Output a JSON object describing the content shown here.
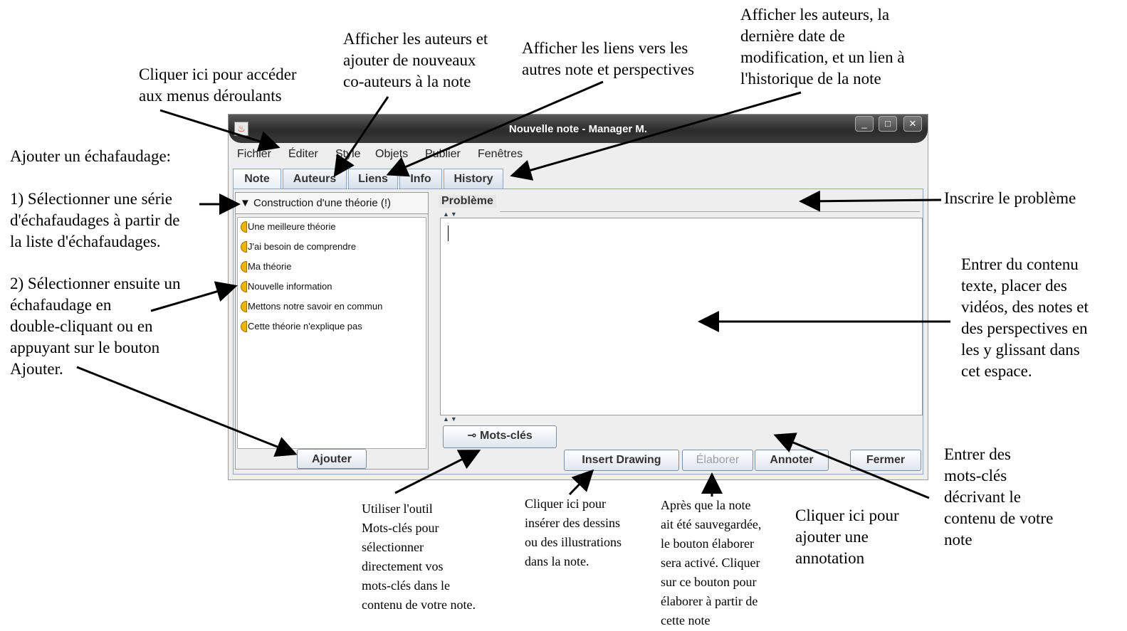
{
  "window": {
    "title": "Nouvelle note - Manager M.",
    "controls": {
      "minimize": "_",
      "maximize": "□",
      "close": "✕"
    }
  },
  "menubar": [
    "Fichier",
    "Éditer",
    "Style",
    "Objets",
    "Publier",
    "Fenêtres"
  ],
  "tabs": [
    "Note",
    "Auteurs",
    "Liens",
    "Info",
    "History"
  ],
  "active_tab": "Note",
  "scaffold": {
    "selected": "Construction d'une théorie (!)",
    "items": [
      "Une meilleure théorie",
      "J'ai besoin de comprendre",
      "Ma théorie",
      "Nouvelle information",
      "Mettons notre savoir en commun",
      "Cette théorie n'explique pas"
    ],
    "add_button": "Ajouter"
  },
  "editor": {
    "problem_label": "Problème",
    "problem_value": "",
    "body_text": ""
  },
  "buttons": {
    "keywords": "Mots-clés",
    "insert_drawing": "Insert Drawing",
    "elaborate": "Élaborer",
    "annotate": "Annoter",
    "close": "Fermer"
  },
  "annotations": {
    "menus": "Cliquer ici pour accéder\naux menus déroulants",
    "authors": "Afficher les auteurs et\najouter de nouveaux\nco-auteurs à la note",
    "links": "Afficher les liens vers les\nautres note et perspectives",
    "info": "Afficher les auteurs, la\ndernière date de\nmodification, et un lien à\nl'historique de la note",
    "scaffold_title": "Ajouter un échafaudage:",
    "scaffold_step1": "1) Sélectionner une série\nd'échafaudages à partir de\nla liste d'échafaudages.",
    "scaffold_step2": "2) Sélectionner ensuite un\néchafaudage en\ndouble-cliquant ou en\nappuyant sur le bouton\nAjouter.",
    "problem": "Inscrire le problème",
    "content": "Entrer du contenu\ntexte, placer des\nvidéos, des notes et\ndes perspectives en\nles y glissant dans\ncet espace.",
    "keywords_desc": "Entrer des\nmots-clés\ndécrivant le\ncontenu de votre\nnote",
    "keywords_tool": "Utiliser l'outil\nMots-clés pour\nsélectionner\ndirectement vos\nmots-clés dans le\ncontenu de votre note.",
    "insert_drawing": "Cliquer ici pour\ninsérer des dessins\nou des illustrations\ndans la note.",
    "elaborate": "Après que la note\nait été sauvegardée,\nle bouton élaborer\nsera activé. Cliquer\nsur ce bouton pour\nélaborer à partir de\ncette note",
    "annotate": "Cliquer ici pour\najouter une\nannotation"
  }
}
